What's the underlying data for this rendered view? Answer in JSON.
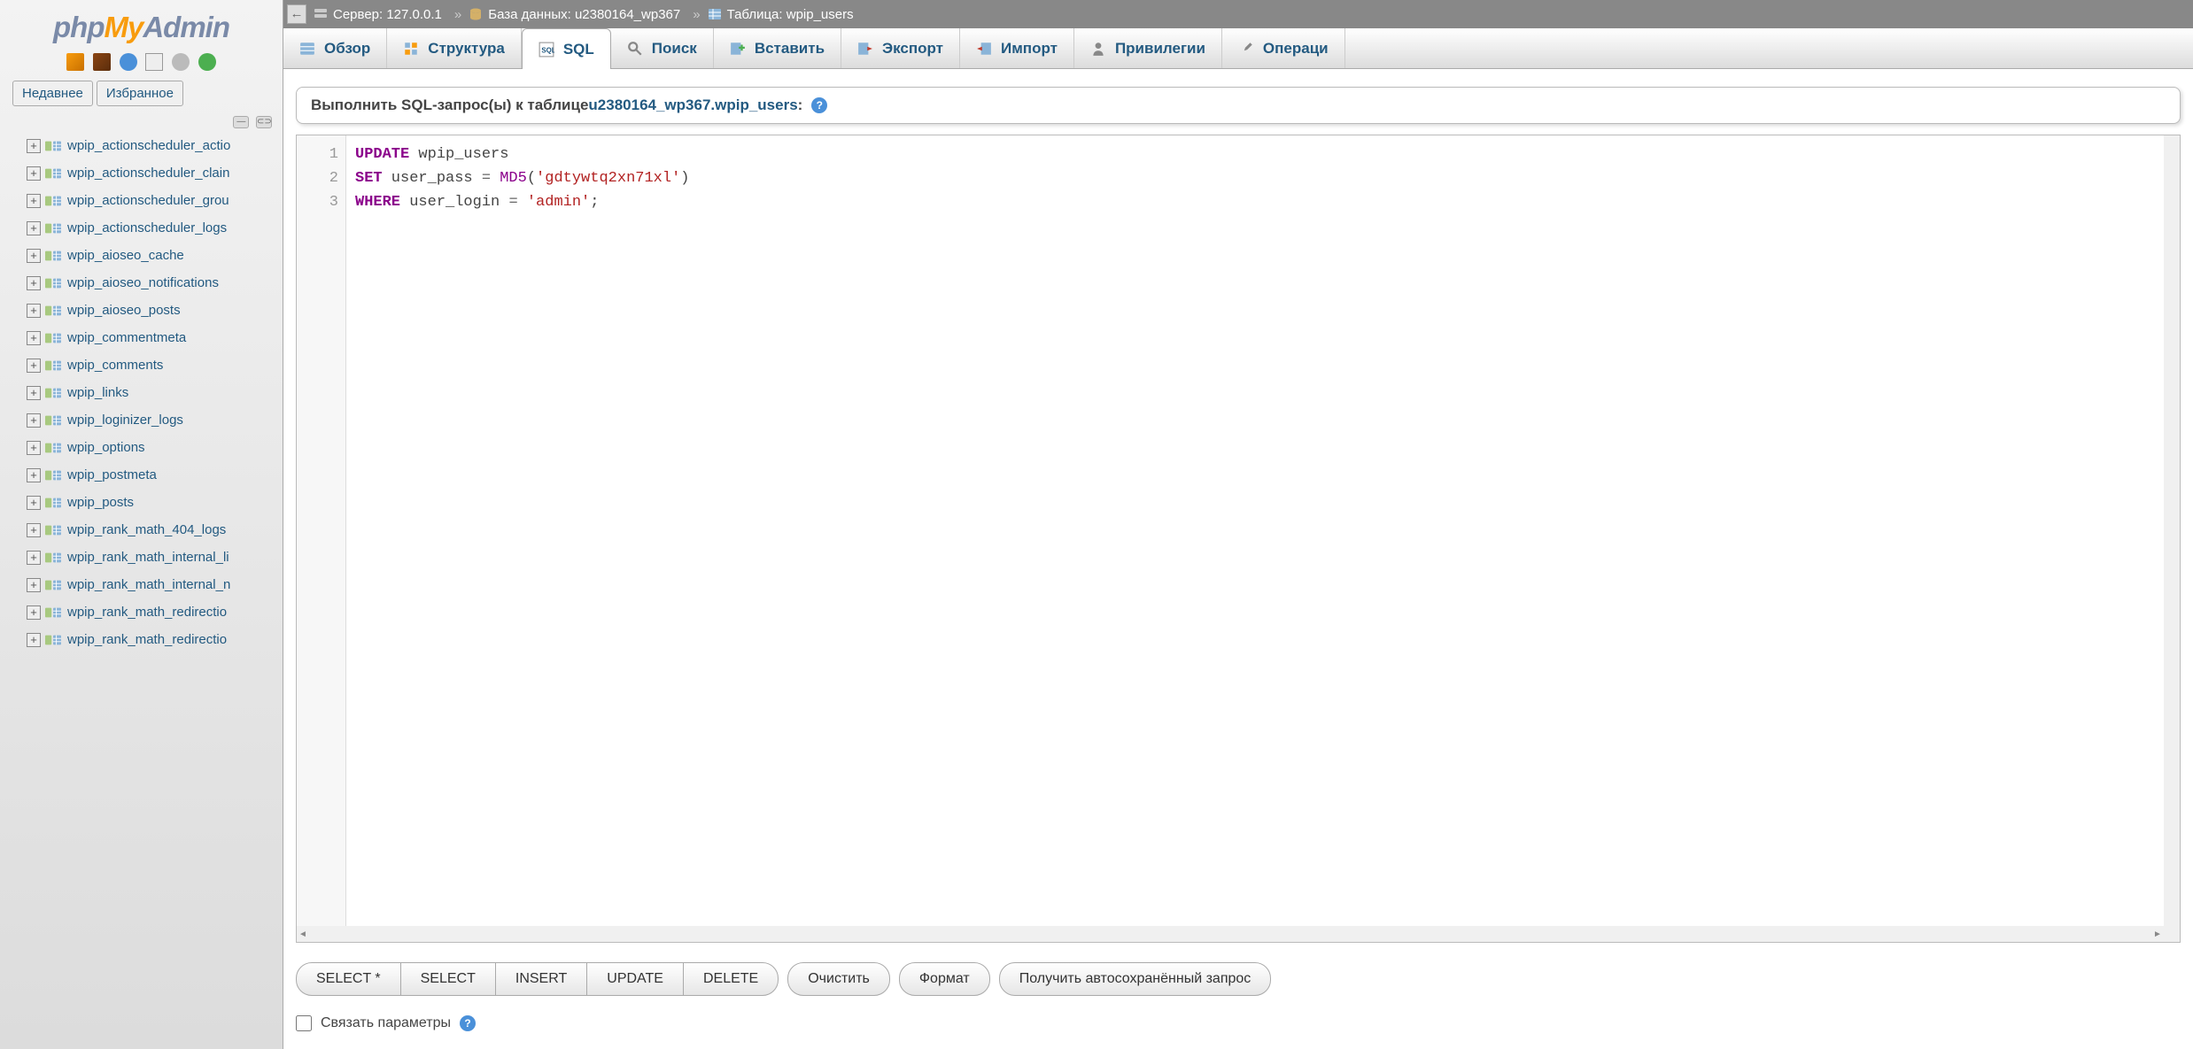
{
  "logo": {
    "php": "php",
    "my": "My",
    "admin": "Admin"
  },
  "sidebar": {
    "nav_recent": "Недавнее",
    "nav_favorite": "Избранное",
    "tables": [
      "wpip_actionscheduler_actio",
      "wpip_actionscheduler_clain",
      "wpip_actionscheduler_grou",
      "wpip_actionscheduler_logs",
      "wpip_aioseo_cache",
      "wpip_aioseo_notifications",
      "wpip_aioseo_posts",
      "wpip_commentmeta",
      "wpip_comments",
      "wpip_links",
      "wpip_loginizer_logs",
      "wpip_options",
      "wpip_postmeta",
      "wpip_posts",
      "wpip_rank_math_404_logs",
      "wpip_rank_math_internal_li",
      "wpip_rank_math_internal_n",
      "wpip_rank_math_redirectio",
      "wpip_rank_math_redirectio"
    ]
  },
  "breadcrumb": {
    "server_label": "Сервер:",
    "server_value": "127.0.0.1",
    "db_label": "База данных:",
    "db_value": "u2380164_wp367",
    "table_label": "Таблица:",
    "table_value": "wpip_users",
    "sep": "»"
  },
  "tabs": {
    "browse": "Обзор",
    "structure": "Структура",
    "sql": "SQL",
    "search": "Поиск",
    "insert": "Вставить",
    "export": "Экспорт",
    "import": "Импорт",
    "privileges": "Привилегии",
    "operations": "Операци"
  },
  "sql_header": {
    "prefix": "Выполнить SQL-запрос(ы) к таблице ",
    "link": "u2380164_wp367.wpip_users",
    "suffix": ": "
  },
  "editor": {
    "lines": [
      "1",
      "2",
      "3"
    ],
    "l1_kw": "UPDATE",
    "l1_tbl": " wpip_users",
    "l2_kw": "SET",
    "l2_col": " user_pass ",
    "l2_eq": "=",
    "l2_fn": " MD5",
    "l2_p1": "(",
    "l2_str": "'gdtywtq2xn71xl'",
    "l2_p2": ")",
    "l3_kw": "WHERE",
    "l3_col": " user_login ",
    "l3_eq": "=",
    "l3_sp": " ",
    "l3_str": "'admin'",
    "l3_semi": ";"
  },
  "buttons": {
    "select_star": "SELECT *",
    "select": "SELECT",
    "insert": "INSERT",
    "update": "UPDATE",
    "delete": "DELETE",
    "clear": "Очистить",
    "format": "Формат",
    "autosave": "Получить автосохранённый запрос"
  },
  "checkbox": {
    "bind_params": "Связать параметры"
  }
}
